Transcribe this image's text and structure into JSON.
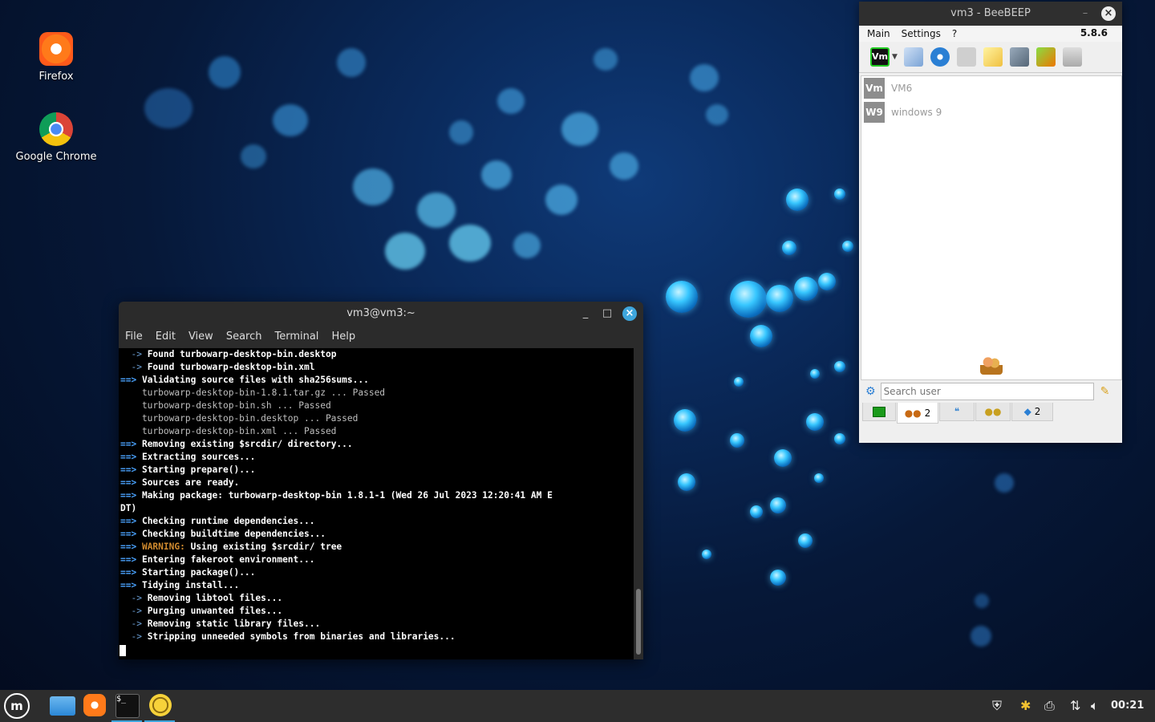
{
  "desktop": {
    "icons": [
      {
        "label": "Firefox",
        "icon": "firefox-icon"
      },
      {
        "label": "Google Chrome",
        "icon": "chrome-icon"
      }
    ]
  },
  "terminal": {
    "title": "vm3@vm3:~",
    "menu": [
      "File",
      "Edit",
      "View",
      "Search",
      "Terminal",
      "Help"
    ],
    "lines": [
      {
        "prefix": "  ->",
        "text": " Found turbowarp-desktop-bin.desktop",
        "kind": "sub"
      },
      {
        "prefix": "  ->",
        "text": " Found turbowarp-desktop-bin.xml",
        "kind": "sub"
      },
      {
        "prefix": "==>",
        "text": " Validating source files with sha256sums...",
        "kind": "main"
      },
      {
        "prefix": "",
        "text": "    turbowarp-desktop-bin-1.8.1.tar.gz ... Passed",
        "kind": "dim"
      },
      {
        "prefix": "",
        "text": "    turbowarp-desktop-bin.sh ... Passed",
        "kind": "dim"
      },
      {
        "prefix": "",
        "text": "    turbowarp-desktop-bin.desktop ... Passed",
        "kind": "dim"
      },
      {
        "prefix": "",
        "text": "    turbowarp-desktop-bin.xml ... Passed",
        "kind": "dim"
      },
      {
        "prefix": "==>",
        "text": " Removing existing $srcdir/ directory...",
        "kind": "main"
      },
      {
        "prefix": "==>",
        "text": " Extracting sources...",
        "kind": "main"
      },
      {
        "prefix": "==>",
        "text": " Starting prepare()...",
        "kind": "main"
      },
      {
        "prefix": "==>",
        "text": " Sources are ready.",
        "kind": "main"
      },
      {
        "prefix": "==>",
        "text": " Making package: turbowarp-desktop-bin 1.8.1-1 (Wed 26 Jul 2023 12:20:41 AM E",
        "kind": "main"
      },
      {
        "prefix": "",
        "text": "DT)",
        "kind": "main"
      },
      {
        "prefix": "==>",
        "text": " Checking runtime dependencies...",
        "kind": "main"
      },
      {
        "prefix": "==>",
        "text": " Checking buildtime dependencies...",
        "kind": "main"
      },
      {
        "prefix": "==>",
        "text": " WARNING:",
        "rest": " Using existing $srcdir/ tree",
        "kind": "warn"
      },
      {
        "prefix": "==>",
        "text": " Entering fakeroot environment...",
        "kind": "main"
      },
      {
        "prefix": "==>",
        "text": " Starting package()...",
        "kind": "main"
      },
      {
        "prefix": "==>",
        "text": " Tidying install...",
        "kind": "main"
      },
      {
        "prefix": "  ->",
        "text": " Removing libtool files...",
        "kind": "sub"
      },
      {
        "prefix": "  ->",
        "text": " Purging unwanted files...",
        "kind": "sub"
      },
      {
        "prefix": "  ->",
        "text": " Removing static library files...",
        "kind": "sub"
      },
      {
        "prefix": "  ->",
        "text": " Stripping unneeded symbols from binaries and libraries...",
        "kind": "sub"
      }
    ]
  },
  "beebeep": {
    "title": "vm3 - BeeBEEP",
    "menu": [
      "Main",
      "Settings",
      "?"
    ],
    "version": "5.8.6",
    "users": [
      {
        "initials": "Vm",
        "name": "VM6"
      },
      {
        "initials": "W9",
        "name": "windows 9"
      }
    ],
    "search_placeholder": "Search user",
    "tabs": [
      {
        "icon": "status-icon",
        "count": ""
      },
      {
        "icon": "users-icon",
        "count": "2"
      },
      {
        "icon": "chat-icon",
        "count": ""
      },
      {
        "icon": "groups-icon",
        "count": ""
      },
      {
        "icon": "shares-icon",
        "count": "2"
      }
    ]
  },
  "taskbar": {
    "clock": "00:21"
  }
}
